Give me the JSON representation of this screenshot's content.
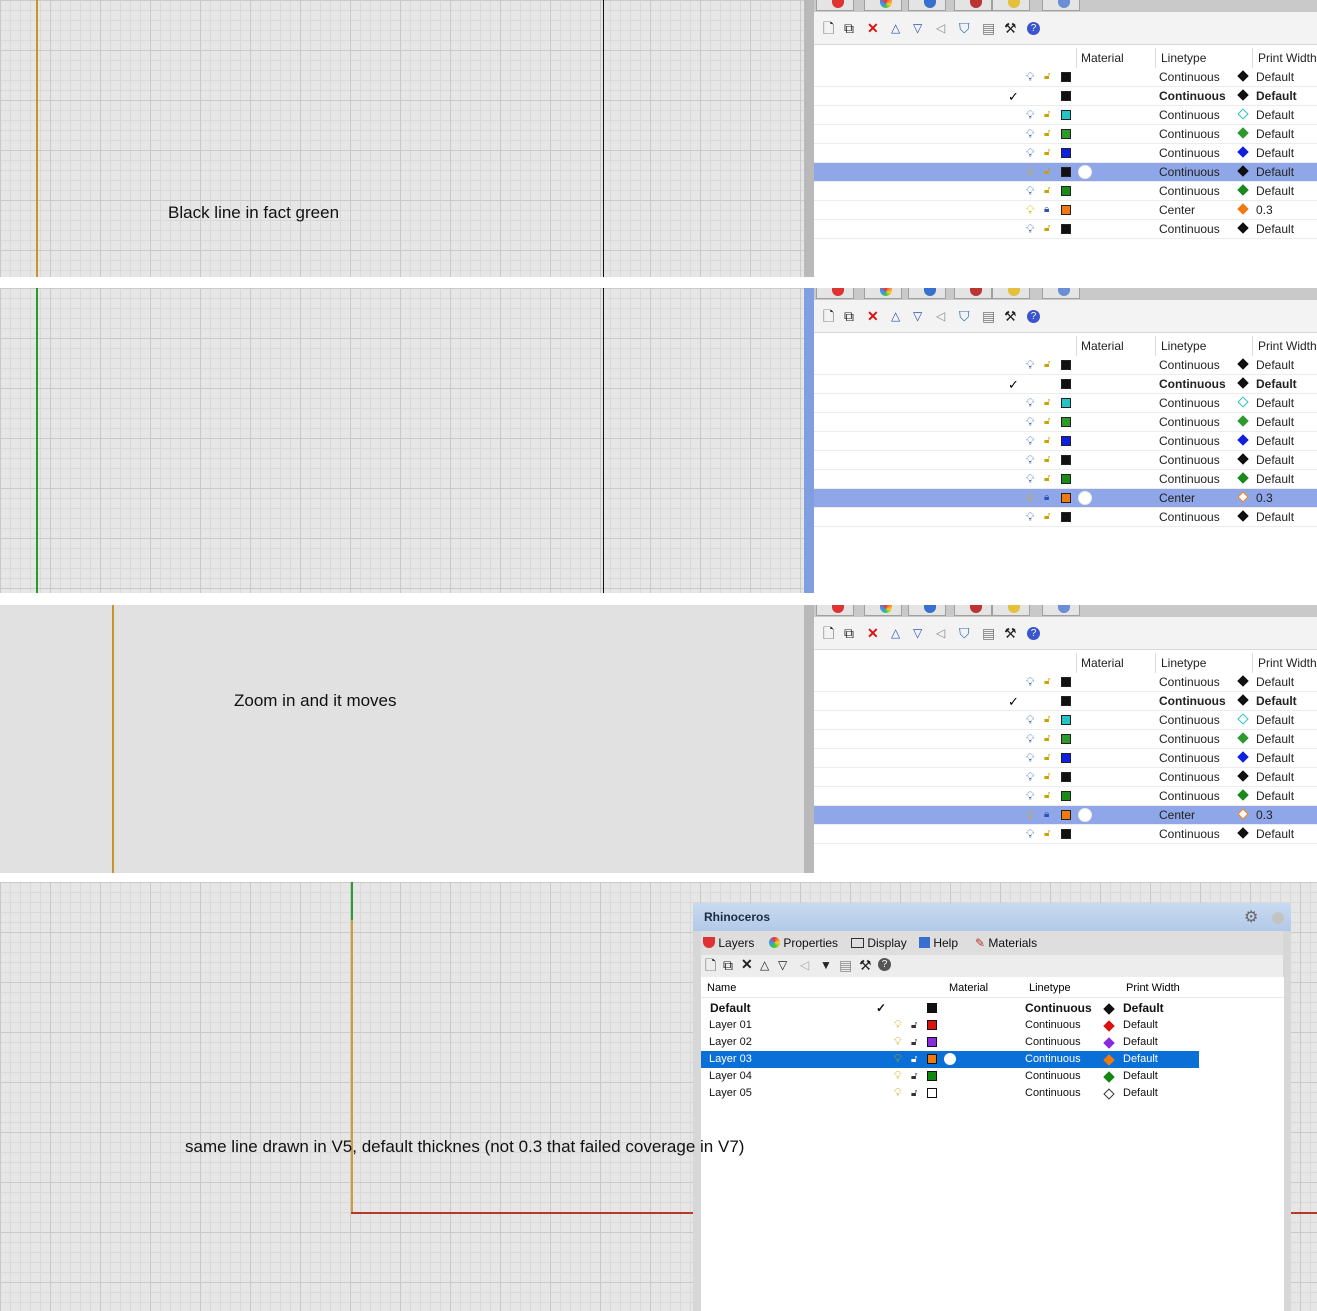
{
  "annotations": {
    "note1": "Black line in fact green",
    "note2": "Zoom in and it moves",
    "note3": "same line drawn in V5, default thicknes (not 0.3 that failed coverage in V7)"
  },
  "v7_panel": {
    "columns": {
      "material": "Material",
      "linetype": "Linetype",
      "print_width": "Print Width"
    },
    "toolbar_icons": [
      "new-layer-icon",
      "new-sublayer-icon",
      "delete-icon",
      "move-up-icon",
      "move-down-icon",
      "move-out-icon",
      "filter-icon",
      "layer-state-icon",
      "tools-icon",
      "help-icon"
    ],
    "screens": [
      {
        "selected_row": 5,
        "rows": [
          {
            "linetype": "Continuous",
            "width": "Default",
            "color": "#111111",
            "bold": false,
            "current": false,
            "locked": false
          },
          {
            "linetype": "Continuous",
            "width": "Default",
            "color": "#111111",
            "bold": true,
            "current": true,
            "locked": false
          },
          {
            "linetype": "Continuous",
            "width": "Default",
            "color": "#28c4c4",
            "bold": false,
            "current": false,
            "locked": false
          },
          {
            "linetype": "Continuous",
            "width": "Default",
            "color": "#2e9a2e",
            "bold": false,
            "current": false,
            "locked": false
          },
          {
            "linetype": "Continuous",
            "width": "Default",
            "color": "#1020e0",
            "bold": false,
            "current": false,
            "locked": false
          },
          {
            "linetype": "Continuous",
            "width": "Default",
            "color": "#111111",
            "bold": false,
            "current": false,
            "locked": false
          },
          {
            "linetype": "Continuous",
            "width": "Default",
            "color": "#1b8a1b",
            "bold": false,
            "current": false,
            "locked": false
          },
          {
            "linetype": "Center",
            "width": "0.3",
            "color": "#f07a10",
            "bold": false,
            "current": false,
            "locked": true
          },
          {
            "linetype": "Continuous",
            "width": "Default",
            "color": "#111111",
            "bold": false,
            "current": false,
            "locked": false
          }
        ]
      },
      {
        "selected_row": 7,
        "rows": [
          {
            "linetype": "Continuous",
            "width": "Default",
            "color": "#111111",
            "bold": false,
            "current": false,
            "locked": false
          },
          {
            "linetype": "Continuous",
            "width": "Default",
            "color": "#111111",
            "bold": true,
            "current": true,
            "locked": false
          },
          {
            "linetype": "Continuous",
            "width": "Default",
            "color": "#28c4c4",
            "bold": false,
            "current": false,
            "locked": false
          },
          {
            "linetype": "Continuous",
            "width": "Default",
            "color": "#2e9a2e",
            "bold": false,
            "current": false,
            "locked": false
          },
          {
            "linetype": "Continuous",
            "width": "Default",
            "color": "#1020e0",
            "bold": false,
            "current": false,
            "locked": false
          },
          {
            "linetype": "Continuous",
            "width": "Default",
            "color": "#111111",
            "bold": false,
            "current": false,
            "locked": false
          },
          {
            "linetype": "Continuous",
            "width": "Default",
            "color": "#1b8a1b",
            "bold": false,
            "current": false,
            "locked": false
          },
          {
            "linetype": "Center",
            "width": "0.3",
            "color": "#f07a10",
            "bold": false,
            "current": false,
            "locked": true
          },
          {
            "linetype": "Continuous",
            "width": "Default",
            "color": "#111111",
            "bold": false,
            "current": false,
            "locked": false
          }
        ]
      },
      {
        "selected_row": 7,
        "rows": [
          {
            "linetype": "Continuous",
            "width": "Default",
            "color": "#111111",
            "bold": false,
            "current": false,
            "locked": false
          },
          {
            "linetype": "Continuous",
            "width": "Default",
            "color": "#111111",
            "bold": true,
            "current": true,
            "locked": false
          },
          {
            "linetype": "Continuous",
            "width": "Default",
            "color": "#28c4c4",
            "bold": false,
            "current": false,
            "locked": false
          },
          {
            "linetype": "Continuous",
            "width": "Default",
            "color": "#2e9a2e",
            "bold": false,
            "current": false,
            "locked": false
          },
          {
            "linetype": "Continuous",
            "width": "Default",
            "color": "#1020e0",
            "bold": false,
            "current": false,
            "locked": false
          },
          {
            "linetype": "Continuous",
            "width": "Default",
            "color": "#111111",
            "bold": false,
            "current": false,
            "locked": false
          },
          {
            "linetype": "Continuous",
            "width": "Default",
            "color": "#1b8a1b",
            "bold": false,
            "current": false,
            "locked": false
          },
          {
            "linetype": "Center",
            "width": "0.3",
            "color": "#f07a10",
            "bold": false,
            "current": false,
            "locked": true
          },
          {
            "linetype": "Continuous",
            "width": "Default",
            "color": "#111111",
            "bold": false,
            "current": false,
            "locked": false
          }
        ]
      }
    ]
  },
  "v5_panel": {
    "title": "Rhinoceros",
    "tabs": [
      "Layers",
      "Properties",
      "Display",
      "Help",
      "Materials"
    ],
    "columns": {
      "name": "Name",
      "material": "Material",
      "linetype": "Linetype",
      "print_width": "Print Width"
    },
    "selected_row": 3,
    "rows": [
      {
        "name": "Default",
        "linetype": "Continuous",
        "width": "Default",
        "color": "#111111",
        "bold": true,
        "current": true
      },
      {
        "name": "Layer 01",
        "linetype": "Continuous",
        "width": "Default",
        "color": "#dd1111",
        "bold": false,
        "current": false
      },
      {
        "name": "Layer 02",
        "linetype": "Continuous",
        "width": "Default",
        "color": "#8a2be2",
        "bold": false,
        "current": false
      },
      {
        "name": "Layer 03",
        "linetype": "Continuous",
        "width": "Default",
        "color": "#f07a10",
        "bold": false,
        "current": false
      },
      {
        "name": "Layer 04",
        "linetype": "Continuous",
        "width": "Default",
        "color": "#118811",
        "bold": false,
        "current": false
      },
      {
        "name": "Layer 05",
        "linetype": "Continuous",
        "width": "Default",
        "color": "#ffffff",
        "bold": false,
        "current": false
      }
    ]
  }
}
